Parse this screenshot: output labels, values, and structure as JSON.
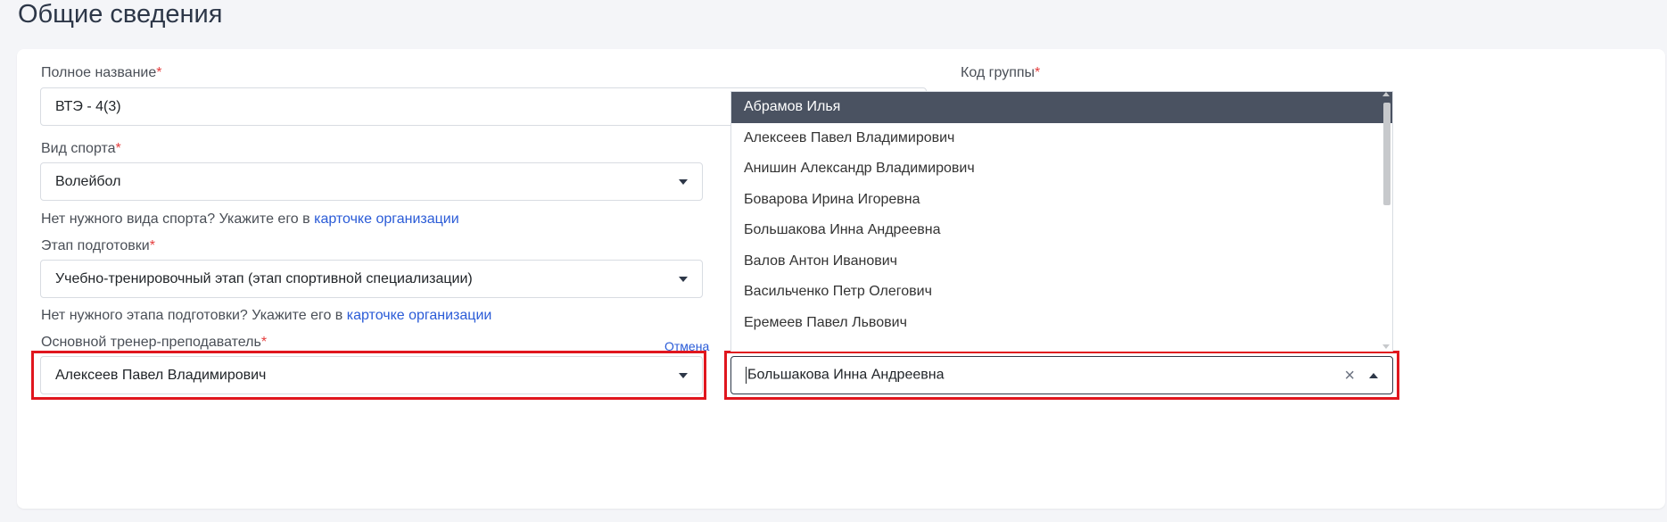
{
  "page": {
    "title": "Общие сведения"
  },
  "form": {
    "full_name": {
      "label": "Полное название",
      "required_mark": "*",
      "value": "ВТЭ - 4(3)"
    },
    "group_code": {
      "label": "Код группы",
      "required_mark": "*"
    },
    "sport": {
      "label": "Вид спорта",
      "required_mark": "*",
      "value": "Волейбол",
      "hint_text": "Нет нужного вида спорта? Укажите его в ",
      "hint_link": "карточке организации"
    },
    "stage": {
      "label": "Этап подготовки",
      "required_mark": "*",
      "value": "Учебно-тренировочный этап (этап спортивной специализации)",
      "hint_text": "Нет нужного этапа подготовки? Укажите его в ",
      "hint_link": "карточке организации"
    },
    "coach": {
      "label": "Основной тренер-преподаватель",
      "required_mark": "*",
      "value": "Алексеев Павел Владимирович",
      "cancel_label": "Отмена"
    },
    "second_coach": {
      "value": "Большакова Инна Андреевна",
      "clear_label": "×"
    }
  },
  "dropdown": {
    "options": [
      "Абрамов Илья",
      "Алексеев Павел Владимирович",
      "Анишин Александр Владимирович",
      "Боварова Ирина Игоревна",
      "Большакова Инна Андреевна",
      "Валов Антон Иванович",
      "Васильченко Петр Олегович",
      "Еремеев Павел Львович"
    ],
    "highlighted_index": 0
  },
  "colors": {
    "accent_link": "#2a5bd7",
    "required": "#e53e3e",
    "highlight_box": "#e0161e",
    "option_active_bg": "#4a5261"
  }
}
